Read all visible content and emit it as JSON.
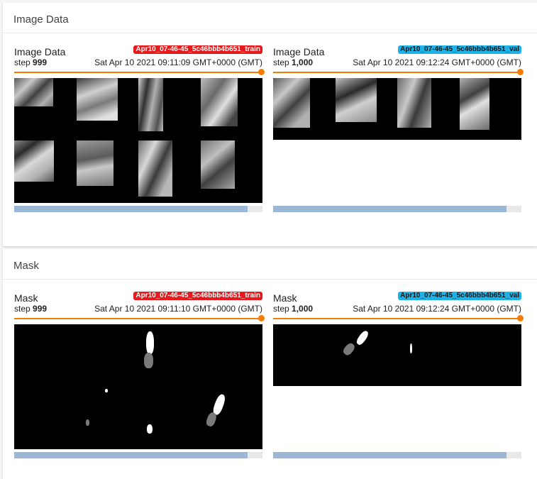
{
  "sections": {
    "image": {
      "title": "Image Data"
    },
    "mask": {
      "title": "Mask"
    }
  },
  "cards": {
    "image_train": {
      "title": "Image Data",
      "run": "Apr10_07-46-45_5c46bbb4b651_train",
      "step_label": "step",
      "step_value": "999",
      "timestamp": "Sat Apr 10 2021 09:11:09 GMT+0000 (GMT)",
      "scroll_fraction": 0.94
    },
    "image_val": {
      "title": "Image Data",
      "run": "Apr10_07-46-45_5c46bbb4b651_val",
      "step_label": "step",
      "step_value": "1,000",
      "timestamp": "Sat Apr 10 2021 09:12:24 GMT+0000 (GMT)",
      "scroll_fraction": 0.94
    },
    "mask_train": {
      "title": "Mask",
      "run": "Apr10_07-46-45_5c46bbb4b651_train",
      "step_label": "step",
      "step_value": "999",
      "timestamp": "Sat Apr 10 2021 09:11:10 GMT+0000 (GMT)",
      "scroll_fraction": 0.94
    },
    "mask_val": {
      "title": "Mask",
      "run": "Apr10_07-46-45_5c46bbb4b651_val",
      "step_label": "step",
      "step_value": "1,000",
      "timestamp": "Sat Apr 10 2021 09:12:24 GMT+0000 (GMT)",
      "scroll_fraction": 0.94
    }
  },
  "colors": {
    "train_run": "#e41a1c",
    "val_run": "#1db2e8",
    "step_slider": "#f57c00",
    "scroll_thumb": "#9ab8d6"
  }
}
